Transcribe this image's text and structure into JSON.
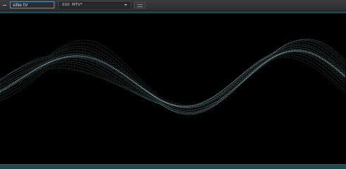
{
  "toolbar": {
    "menu_icon": "minus-icon",
    "name_field_value": "siNe tV",
    "preset_number": "010",
    "preset_name": "MTV*",
    "dropdown_icon": "chevron-down-icon",
    "options_icon": "menu-lines-icon"
  },
  "colors": {
    "accent": "#5e8fb8",
    "wave": "#a9dde0",
    "band": "#22494b"
  }
}
